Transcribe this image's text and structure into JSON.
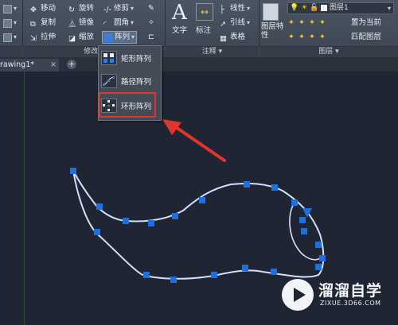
{
  "ribbon": {
    "modify": {
      "move": "移动",
      "rotate": "旋转",
      "trim": "修剪",
      "copy": "复制",
      "mirror": "镜像",
      "fillet": "圆角",
      "stretch": "拉伸",
      "scale": "缩放",
      "array": "阵列",
      "panel_title": "修改"
    },
    "annotation": {
      "text": "文字",
      "dimension": "标注",
      "linear": "线性",
      "leader": "引线",
      "table": "表格",
      "panel_title": "注释"
    },
    "layers": {
      "layer_properties": "图层特性",
      "current_layer": "图层1",
      "set_current": "置为当前",
      "match_layer": "匹配图层",
      "panel_title": "图层"
    }
  },
  "array_menu": {
    "items": [
      "矩形阵列",
      "路径阵列",
      "环形阵列"
    ]
  },
  "tabs": {
    "drawing": "rawing1*",
    "close": "×",
    "new": "+"
  },
  "watermark": {
    "title": "溜溜自学",
    "url": "ZIXUE.3D66.COM"
  },
  "colors": {
    "canvas": "#1f2532",
    "curve": "#cfe0ff",
    "grip": "#1e6fe0",
    "highlight": "#e2342f",
    "arrow": "#e2342f"
  }
}
